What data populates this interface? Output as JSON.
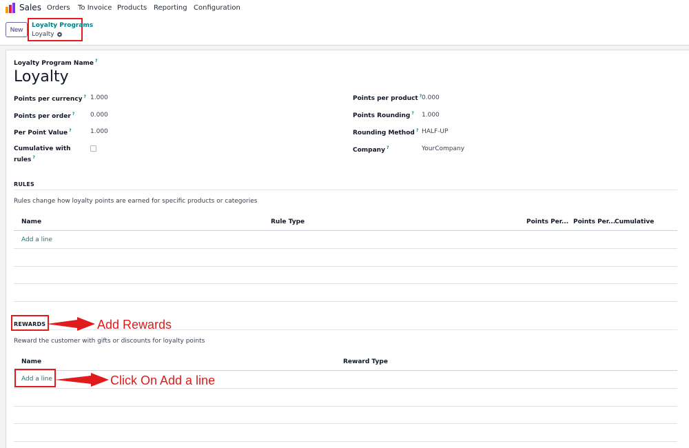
{
  "app": {
    "name": "Sales"
  },
  "menu": [
    "Orders",
    "To Invoice",
    "Products",
    "Reporting",
    "Configuration"
  ],
  "control_panel": {
    "new_label": "New",
    "breadcrumb_parent": "Loyalty Programs",
    "breadcrumb_current": "Loyalty"
  },
  "form": {
    "program_name_label": "Loyalty Program Name",
    "program_name": "Loyalty",
    "left_fields": [
      {
        "label": "Points per currency",
        "value": "1.000"
      },
      {
        "label": "Points per order",
        "value": "0.000"
      },
      {
        "label": "Per Point Value",
        "value": "1.000"
      },
      {
        "label_line1": "Cumulative with",
        "label_line2": "rules",
        "checked": false
      }
    ],
    "right_fields": [
      {
        "label": "Points per product",
        "value": "0.000"
      },
      {
        "label": "Points Rounding",
        "value": "1.000"
      },
      {
        "label": "Rounding Method",
        "value": "HALF-UP"
      },
      {
        "label": "Company",
        "value": "YourCompany"
      }
    ]
  },
  "rules": {
    "title": "RULES",
    "description": "Rules change how loyalty points are earned for specific products or categories",
    "columns": [
      "Name",
      "Rule Type",
      "Points Per...",
      "Points Per...",
      "Cumulative"
    ],
    "add_line": "Add a line"
  },
  "rewards": {
    "title": "REWARDS",
    "description": "Reward the customer with gifts or discounts for loyalty points",
    "columns": [
      "Name",
      "Reward Type"
    ],
    "add_line": "Add a line"
  },
  "annotations": {
    "rewards_note": "Add Rewards",
    "add_line_note": "Click On Add a line",
    "color": "#e01b1b"
  },
  "colors": {
    "accent": "#017e84",
    "brand": "#71639e",
    "annotation": "#e01b1b"
  },
  "icons": {
    "help": "?",
    "gear": "gear-icon",
    "logo": "sales-app-icon"
  }
}
